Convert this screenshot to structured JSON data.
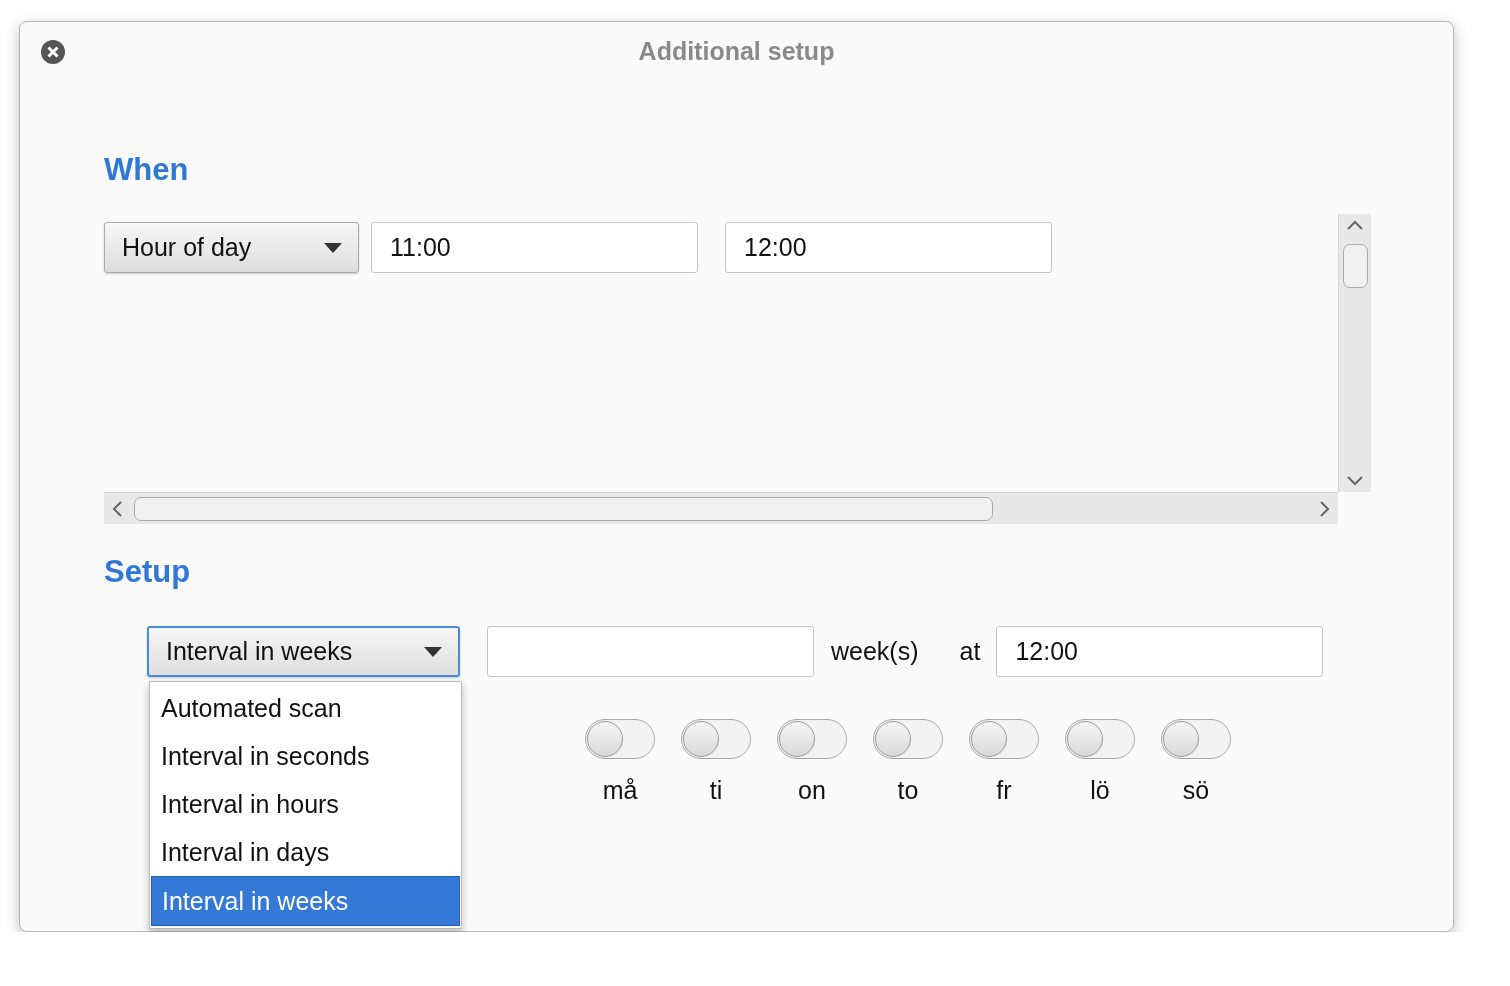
{
  "window": {
    "title": "Additional setup"
  },
  "when": {
    "heading": "When",
    "mode": {
      "value": "Hour of day"
    },
    "from": {
      "value": "11:00"
    },
    "to": {
      "value": "12:00"
    }
  },
  "setup": {
    "heading": "Setup",
    "mode": {
      "value": "Interval in weeks",
      "expanded": true,
      "options": [
        {
          "label": "Automated scan",
          "selected": false
        },
        {
          "label": "Interval in seconds",
          "selected": false
        },
        {
          "label": "Interval in hours",
          "selected": false
        },
        {
          "label": "Interval in days",
          "selected": false
        },
        {
          "label": "Interval in weeks",
          "selected": true
        }
      ]
    },
    "unit": "week(s)",
    "at_label": "at",
    "time": {
      "value": "12:00"
    },
    "days": [
      {
        "label": "må",
        "on": false
      },
      {
        "label": "ti",
        "on": false
      },
      {
        "label": "on",
        "on": false
      },
      {
        "label": "to",
        "on": false
      },
      {
        "label": "fr",
        "on": false
      },
      {
        "label": "lö",
        "on": false
      },
      {
        "label": "sö",
        "on": false
      }
    ]
  }
}
